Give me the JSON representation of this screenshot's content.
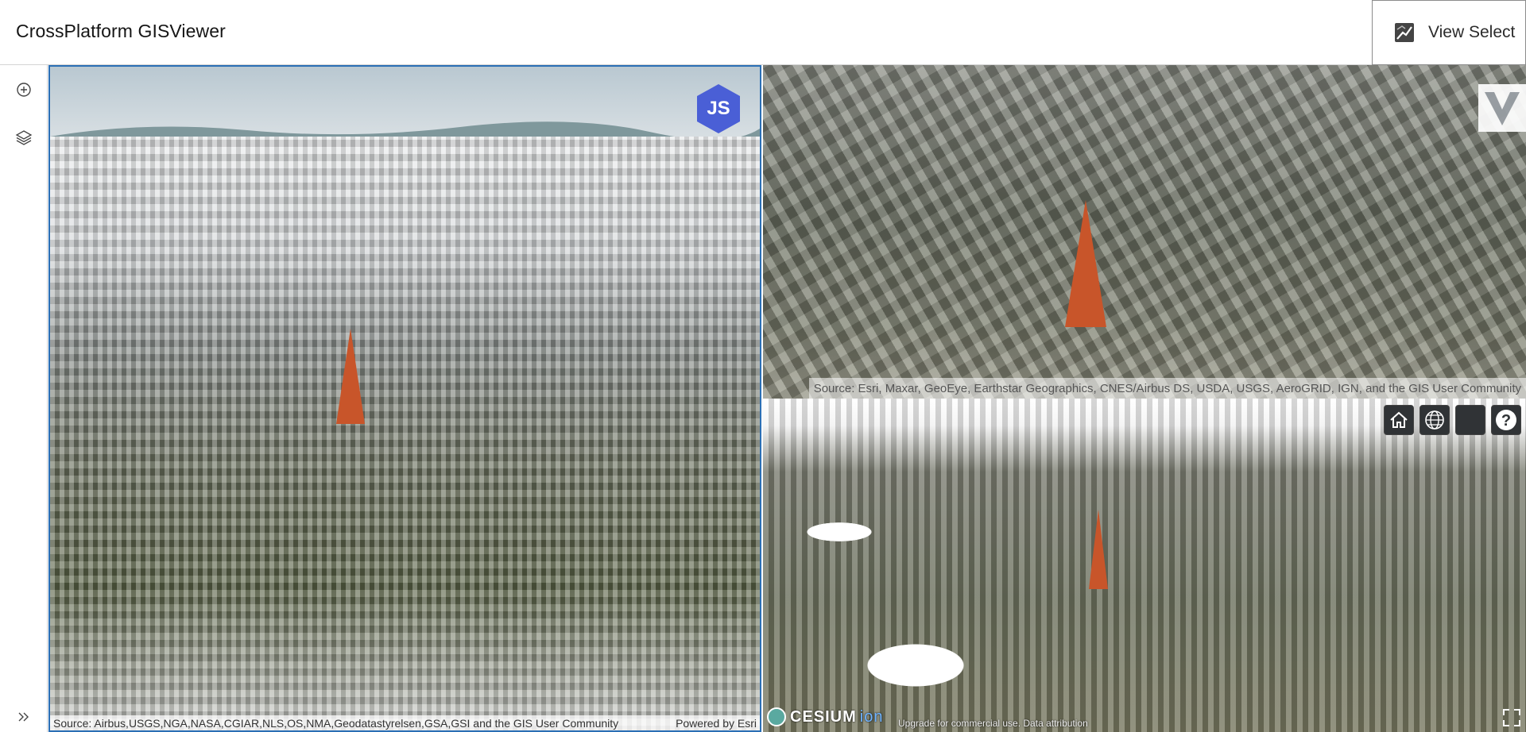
{
  "header": {
    "app_title": "CrossPlatform GISViewer",
    "view_select_label": "View Select"
  },
  "toolbar": {
    "items": [
      {
        "name": "add-circle-icon"
      },
      {
        "name": "layers-icon"
      },
      {
        "name": "expand-chevrons-icon"
      }
    ]
  },
  "panes": {
    "left": {
      "logo": "JS",
      "attribution_source": "Source: Airbus,USGS,NGA,NASA,CGIAR,NLS,OS,NMA,Geodatastyrelsen,GSA,GSI and the GIS User Community",
      "attribution_powered": "Powered by Esri"
    },
    "top_right": {
      "attribution": "Source: Esri, Maxar, GeoEye, Earthstar Geographics, CNES/Airbus DS, USDA, USGS, AeroGRID, IGN, and the GIS User Community"
    },
    "bottom_right": {
      "logo_text": "CESIUM",
      "logo_suffix": "ion",
      "credit": "Upgrade for commercial use.  Data attribution",
      "buttons": [
        "home-icon",
        "globe-icon",
        "scene-mode-button",
        "help-icon"
      ]
    }
  },
  "colors": {
    "accent_border": "#2b6fb5",
    "js_logo": "#4a5fd6",
    "cesium_button_bg": "#303336"
  }
}
